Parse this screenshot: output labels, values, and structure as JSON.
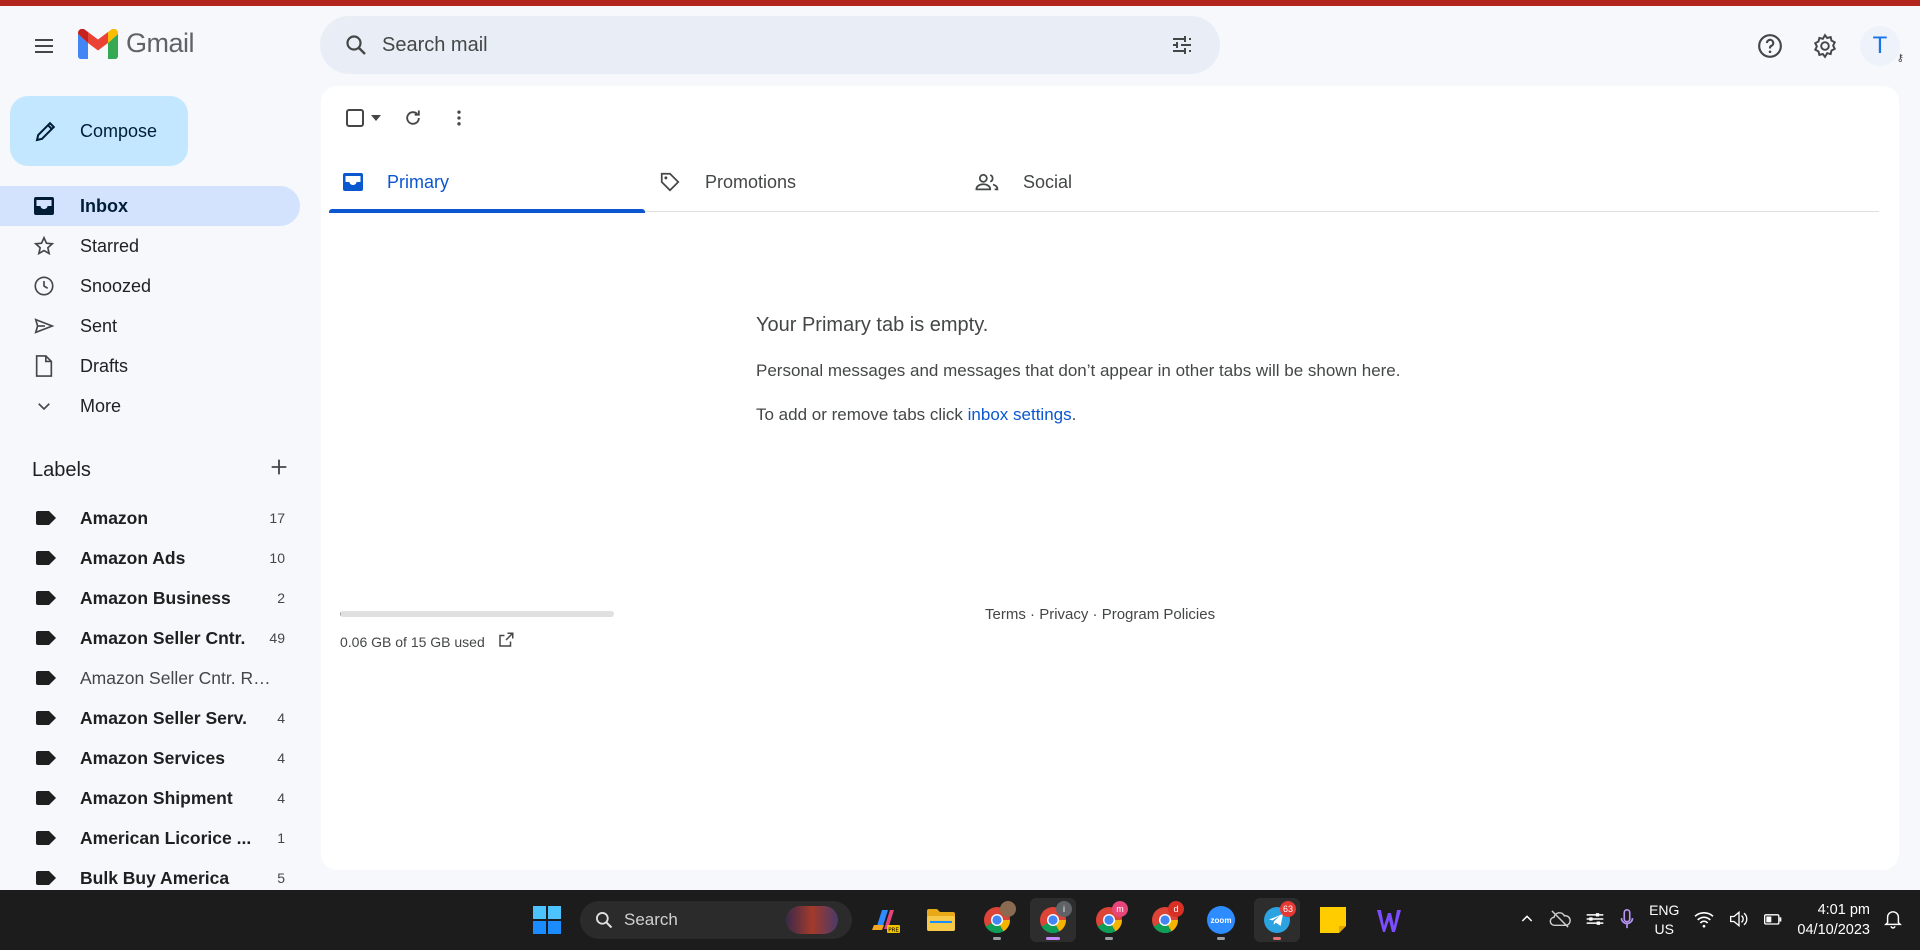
{
  "app": {
    "name": "Gmail"
  },
  "search": {
    "placeholder": "Search mail"
  },
  "header": {
    "avatar_initial": "T"
  },
  "compose": {
    "label": "Compose"
  },
  "nav": [
    {
      "label": "Inbox",
      "icon": "inbox-icon",
      "active": true
    },
    {
      "label": "Starred",
      "icon": "star-icon"
    },
    {
      "label": "Snoozed",
      "icon": "clock-icon"
    },
    {
      "label": "Sent",
      "icon": "send-icon"
    },
    {
      "label": "Drafts",
      "icon": "draft-icon"
    },
    {
      "label": "More",
      "icon": "chevron-down-icon"
    }
  ],
  "labels": {
    "title": "Labels",
    "items": [
      {
        "name": "Amazon",
        "count": "17",
        "bold": true
      },
      {
        "name": "Amazon Ads",
        "count": "10",
        "bold": true
      },
      {
        "name": "Amazon Business",
        "count": "2",
        "bold": true
      },
      {
        "name": "Amazon Seller Cntr.",
        "count": "49",
        "bold": true
      },
      {
        "name": "Amazon Seller Cntr. Ref...",
        "count": "",
        "bold": false
      },
      {
        "name": "Amazon Seller Serv.",
        "count": "4",
        "bold": true
      },
      {
        "name": "Amazon Services",
        "count": "4",
        "bold": true
      },
      {
        "name": "Amazon Shipment",
        "count": "4",
        "bold": true
      },
      {
        "name": "American Licorice ...",
        "count": "1",
        "bold": true
      },
      {
        "name": "Bulk Buy America",
        "count": "5",
        "bold": true
      }
    ]
  },
  "tabs": [
    {
      "label": "Primary",
      "icon": "inbox-icon",
      "active": true
    },
    {
      "label": "Promotions",
      "icon": "tag-icon"
    },
    {
      "label": "Social",
      "icon": "people-icon"
    }
  ],
  "empty": {
    "title": "Your Primary tab is empty.",
    "line1": "Personal messages and messages that don’t appear in other tabs will be shown here.",
    "line2_prefix": "To add or remove tabs click ",
    "line2_link": "inbox settings",
    "line2_suffix": "."
  },
  "storage": {
    "text": "0.06 GB of 15 GB used",
    "fraction": 0.004
  },
  "footer": {
    "terms": "Terms",
    "privacy": "Privacy",
    "policies": "Program Policies",
    "sep": " · "
  },
  "taskbar": {
    "search_label": "Search",
    "badges": {
      "chrome_i": "i",
      "chrome_m": "m",
      "chrome_d": "d",
      "telegram": "63"
    },
    "zoom_label": "zoom",
    "lang_top": "ENG",
    "lang_bottom": "US",
    "time": "4:01 pm",
    "date": "04/10/2023"
  },
  "colors": {
    "accent": "#0b57d0",
    "compose_bg": "#c2e7ff",
    "nav_active_bg": "#d3e3fd",
    "top_stripe": "#b3261e"
  }
}
